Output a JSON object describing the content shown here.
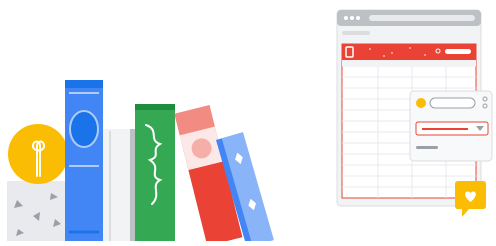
{
  "illustration": {
    "colors": {
      "google_blue": "#4285F4",
      "google_red": "#EA4335",
      "google_yellow": "#FBBC04",
      "google_green": "#34A853",
      "light_gray": "#DADCE0",
      "mid_gray": "#BDC1C6",
      "dark_gray": "#9AA0A6"
    },
    "icons": [
      "lightbulb-icon",
      "heart-icon",
      "dropdown-arrow-icon"
    ]
  }
}
